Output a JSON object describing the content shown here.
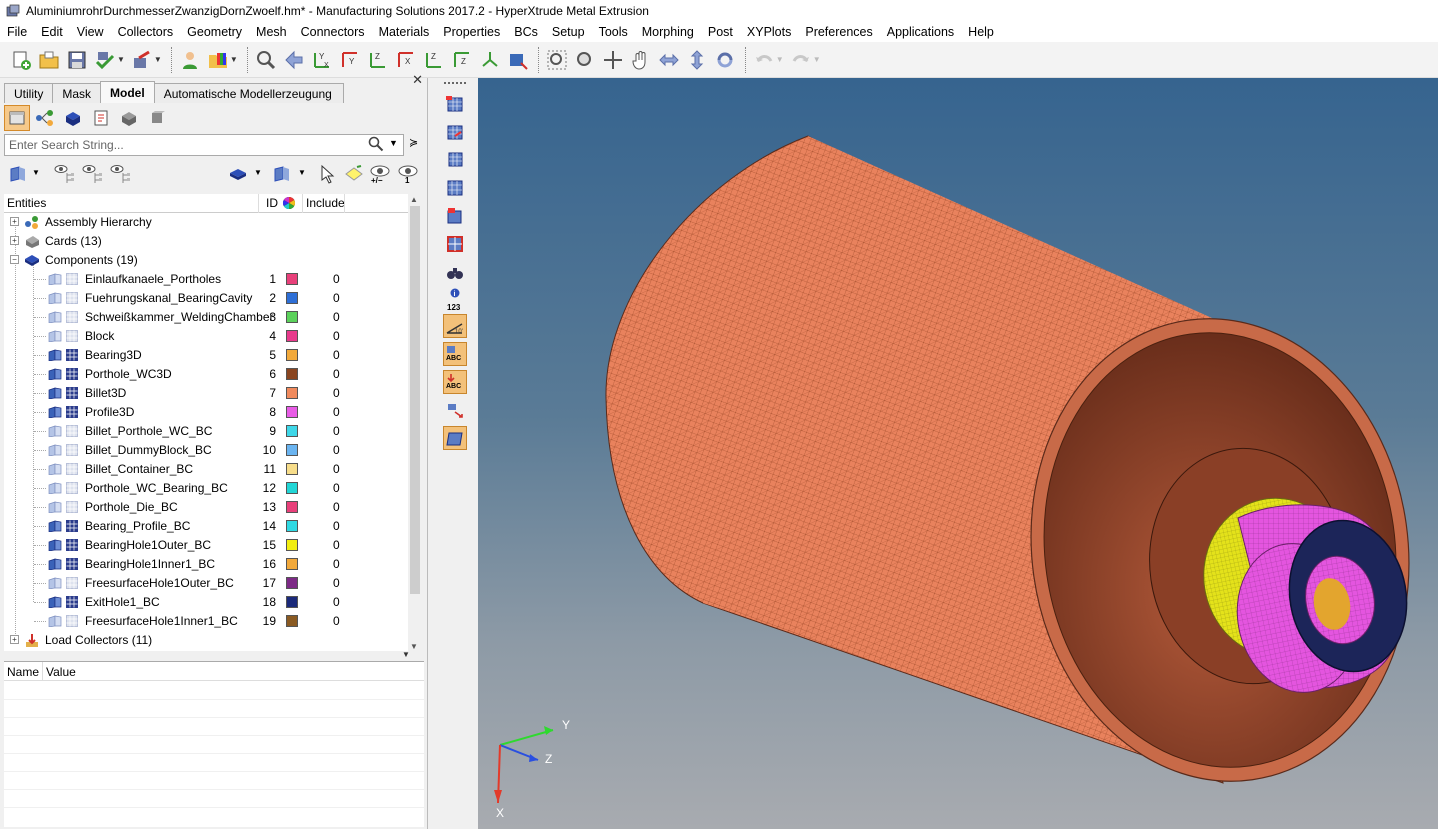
{
  "window": {
    "title": "AluminiumrohrDurchmesserZwanzigDornZwoelf.hm* - Manufacturing Solutions 2017.2 - HyperXtrude Metal Extrusion"
  },
  "menu": [
    "File",
    "Edit",
    "View",
    "Collectors",
    "Geometry",
    "Mesh",
    "Connectors",
    "Materials",
    "Properties",
    "BCs",
    "Setup",
    "Tools",
    "Morphing",
    "Post",
    "XYPlots",
    "Preferences",
    "Applications",
    "Help"
  ],
  "tabs": [
    "Utility",
    "Mask",
    "Model",
    "Automatische Modellerzeugung"
  ],
  "active_tab": "Model",
  "search": {
    "placeholder": "Enter Search String..."
  },
  "tree": {
    "columns": {
      "entities": "Entities",
      "id": "ID",
      "include": "Include"
    },
    "groups": [
      {
        "label": "Assembly Hierarchy",
        "expanded": false
      },
      {
        "label": "Cards (13)",
        "expanded": false
      },
      {
        "label": "Components (19)",
        "expanded": true
      }
    ],
    "components": [
      {
        "name": "Einlaufkanaele_Portholes",
        "id": "1",
        "color": "#e8407a",
        "include": "0",
        "shown": false
      },
      {
        "name": "Fuehrungskanal_BearingCavity",
        "id": "2",
        "color": "#2e6fd6",
        "include": "0",
        "shown": false
      },
      {
        "name": "Schweißkammer_WeldingChamber",
        "id": "3",
        "color": "#5bd15b",
        "include": "0",
        "shown": false
      },
      {
        "name": "Block",
        "id": "4",
        "color": "#e83a8c",
        "include": "0",
        "shown": false
      },
      {
        "name": "Bearing3D",
        "id": "5",
        "color": "#f2a93b",
        "include": "0",
        "shown": true
      },
      {
        "name": "Porthole_WC3D",
        "id": "6",
        "color": "#8a4520",
        "include": "0",
        "shown": true
      },
      {
        "name": "Billet3D",
        "id": "7",
        "color": "#f08a5d",
        "include": "0",
        "shown": true
      },
      {
        "name": "Profile3D",
        "id": "8",
        "color": "#e85ce6",
        "include": "0",
        "shown": true
      },
      {
        "name": "Billet_Porthole_WC_BC",
        "id": "9",
        "color": "#3ed7e8",
        "include": "0",
        "shown": false
      },
      {
        "name": "Billet_DummyBlock_BC",
        "id": "10",
        "color": "#6ab4f0",
        "include": "0",
        "shown": false
      },
      {
        "name": "Billet_Container_BC",
        "id": "11",
        "color": "#f7dd8a",
        "include": "0",
        "shown": false
      },
      {
        "name": "Porthole_WC_Bearing_BC",
        "id": "12",
        "color": "#22d6d6",
        "include": "0",
        "shown": false
      },
      {
        "name": "Porthole_Die_BC",
        "id": "13",
        "color": "#e8407a",
        "include": "0",
        "shown": false
      },
      {
        "name": "Bearing_Profile_BC",
        "id": "14",
        "color": "#2fd9e3",
        "include": "0",
        "shown": true
      },
      {
        "name": "BearingHole1Outer_BC",
        "id": "15",
        "color": "#f2ee10",
        "include": "0",
        "shown": true
      },
      {
        "name": "BearingHole1Inner1_BC",
        "id": "16",
        "color": "#f2a93b",
        "include": "0",
        "shown": true
      },
      {
        "name": "FreesurfaceHole1Outer_BC",
        "id": "17",
        "color": "#7d2a86",
        "include": "0",
        "shown": false
      },
      {
        "name": "ExitHole1_BC",
        "id": "18",
        "color": "#1b2a7a",
        "include": "0",
        "shown": true
      },
      {
        "name": "FreesurfaceHole1Inner1_BC",
        "id": "19",
        "color": "#8a5a22",
        "include": "0",
        "shown": false
      }
    ],
    "after": {
      "label": "Load Collectors (11)",
      "expanded": false
    }
  },
  "properties": {
    "name_col": "Name",
    "value_col": "Value"
  },
  "filter_labels": {
    "plusminus": "+/−",
    "one": "1"
  },
  "vtool_labels": {
    "info_num": "123",
    "abc": "ABC"
  },
  "axes": {
    "x": "X",
    "y": "Y",
    "z": "Z"
  },
  "colors": {
    "billet": "#e9825d",
    "profile": "#e455df",
    "bearing_ring": "#e4e21a",
    "exit": "#1c2559",
    "hl": "#f3c17a"
  }
}
